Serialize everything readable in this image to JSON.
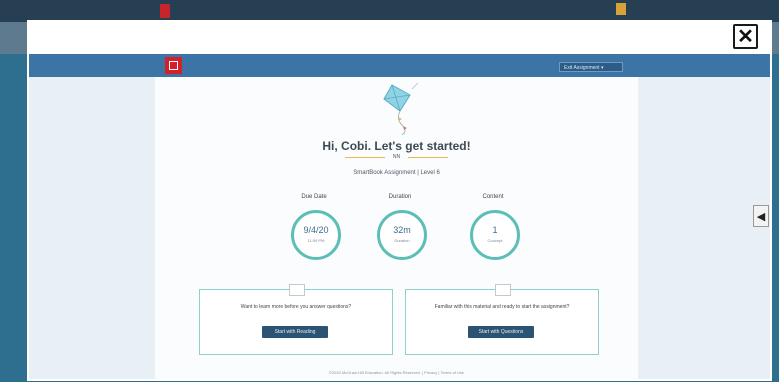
{
  "background": {
    "left_text": "",
    "right_text": ""
  },
  "overlay": {
    "close_icon": "✕",
    "side_tab_icon": "◀"
  },
  "app_bar": {
    "exit_label": "Exit Assignment ▾"
  },
  "intro": {
    "greeting": "Hi, Cobi. Let's get started!",
    "course_code": "NN",
    "subtitle": "SmartBook Assignment | Level 6"
  },
  "stats": [
    {
      "label": "Due Date",
      "value": "9/4/20",
      "sub": "11:59 PM"
    },
    {
      "label": "Duration",
      "value": "32m",
      "sub": "Duration"
    },
    {
      "label": "Content",
      "value": "1",
      "sub": "Concept"
    }
  ],
  "cards": [
    {
      "question": "Want to learn more before you answer questions?",
      "button": "Start with Reading",
      "icon": "book-icon"
    },
    {
      "question": "Familiar with this material and ready to start the assignment?",
      "button": "Start with Questions",
      "icon": "pencil-icon"
    }
  ],
  "footer": {
    "text": "©2020 McGraw-Hill Education. All Rights Reserved.  |  Privacy  |  Terms of Use"
  },
  "colors": {
    "accent": "#5cbfb7",
    "app_bar": "#3b74a5",
    "button": "#2b5373",
    "brand": "#d3212b"
  }
}
